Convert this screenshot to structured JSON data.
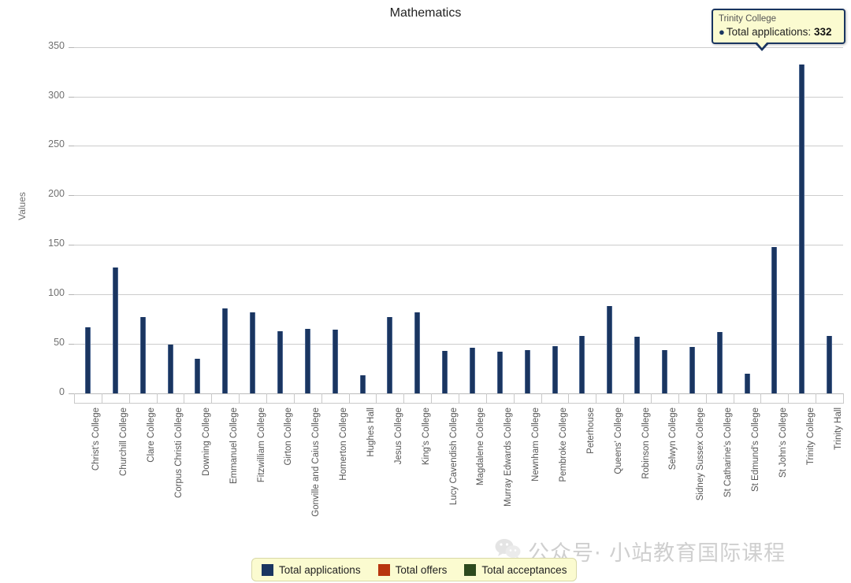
{
  "chart_data": {
    "type": "bar",
    "title": "Mathematics",
    "xlabel": "",
    "ylabel": "Values",
    "ylim": [
      0,
      360
    ],
    "yticks": [
      0,
      50,
      100,
      150,
      200,
      250,
      300,
      350
    ],
    "grid": true,
    "legend_position": "bottom",
    "categories": [
      "Christ's College",
      "Churchill College",
      "Clare College",
      "Corpus Christi College",
      "Downing College",
      "Emmanuel College",
      "Fitzwilliam College",
      "Girton College",
      "Gonville and Caius College",
      "Homerton College",
      "Hughes Hall",
      "Jesus College",
      "King's College",
      "Lucy Cavendish College",
      "Magdalene College",
      "Murray Edwards College",
      "Newnham College",
      "Pembroke College",
      "Peterhouse",
      "Queens' College",
      "Robinson College",
      "Selwyn College",
      "Sidney Sussex College",
      "St Catharine's College",
      "St Edmund's College",
      "St John's College",
      "Trinity College",
      "Trinity Hall"
    ],
    "series": [
      {
        "name": "Total applications",
        "color": "#1a3560",
        "values": [
          67,
          127,
          77,
          49,
          35,
          86,
          82,
          63,
          65,
          64,
          18,
          77,
          82,
          43,
          46,
          42,
          44,
          48,
          58,
          88,
          57,
          44,
          47,
          62,
          20,
          148,
          332,
          58
        ]
      },
      {
        "name": "Total offers",
        "color": "#b8350e",
        "values": []
      },
      {
        "name": "Total acceptances",
        "color": "#2d4a1e",
        "values": []
      }
    ]
  },
  "tooltip": {
    "title": "Trinity College",
    "bullet": "●",
    "series_label": "Total applications:",
    "value": "332"
  },
  "legend": {
    "items": [
      {
        "label": "Total applications",
        "color": "#1a3560"
      },
      {
        "label": "Total offers",
        "color": "#b8350e"
      },
      {
        "label": "Total acceptances",
        "color": "#2d4a1e"
      }
    ]
  },
  "watermark": {
    "icon": "wechat-icon",
    "text": "公众号· 小站教育国际课程"
  }
}
